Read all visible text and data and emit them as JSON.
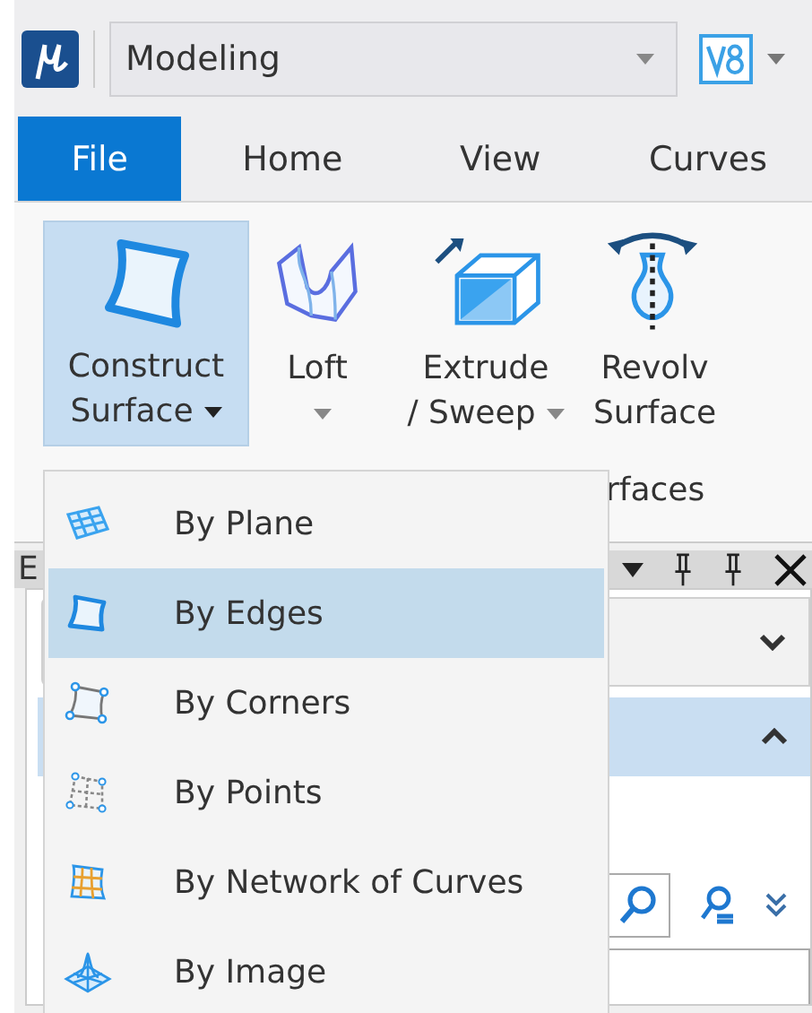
{
  "workflow": {
    "value": "Modeling"
  },
  "tabs": [
    {
      "label": "File",
      "selected": true
    },
    {
      "label": "Home",
      "selected": false
    },
    {
      "label": "View",
      "selected": false
    },
    {
      "label": "Curves",
      "selected": false
    }
  ],
  "ribbon": {
    "buttons": [
      {
        "lines": [
          "Construct",
          "Surface"
        ],
        "has_menu": true,
        "expanded": true
      },
      {
        "lines": [
          "Loft"
        ],
        "has_menu": true,
        "expanded": false
      },
      {
        "lines": [
          "Extrude",
          "/ Sweep"
        ],
        "has_menu": true,
        "expanded": false
      },
      {
        "lines": [
          "Revolv",
          "Surface"
        ],
        "has_menu": false,
        "expanded": false
      }
    ],
    "group_label": "rfaces"
  },
  "panel": {
    "title": "E"
  },
  "menu": {
    "items": [
      {
        "label": "By Plane",
        "selected": false
      },
      {
        "label": "By Edges",
        "selected": true
      },
      {
        "label": "By Corners",
        "selected": false
      },
      {
        "label": "By Points",
        "selected": false
      },
      {
        "label": "By Network of Curves",
        "selected": false
      },
      {
        "label": "By Image",
        "selected": false
      }
    ]
  }
}
